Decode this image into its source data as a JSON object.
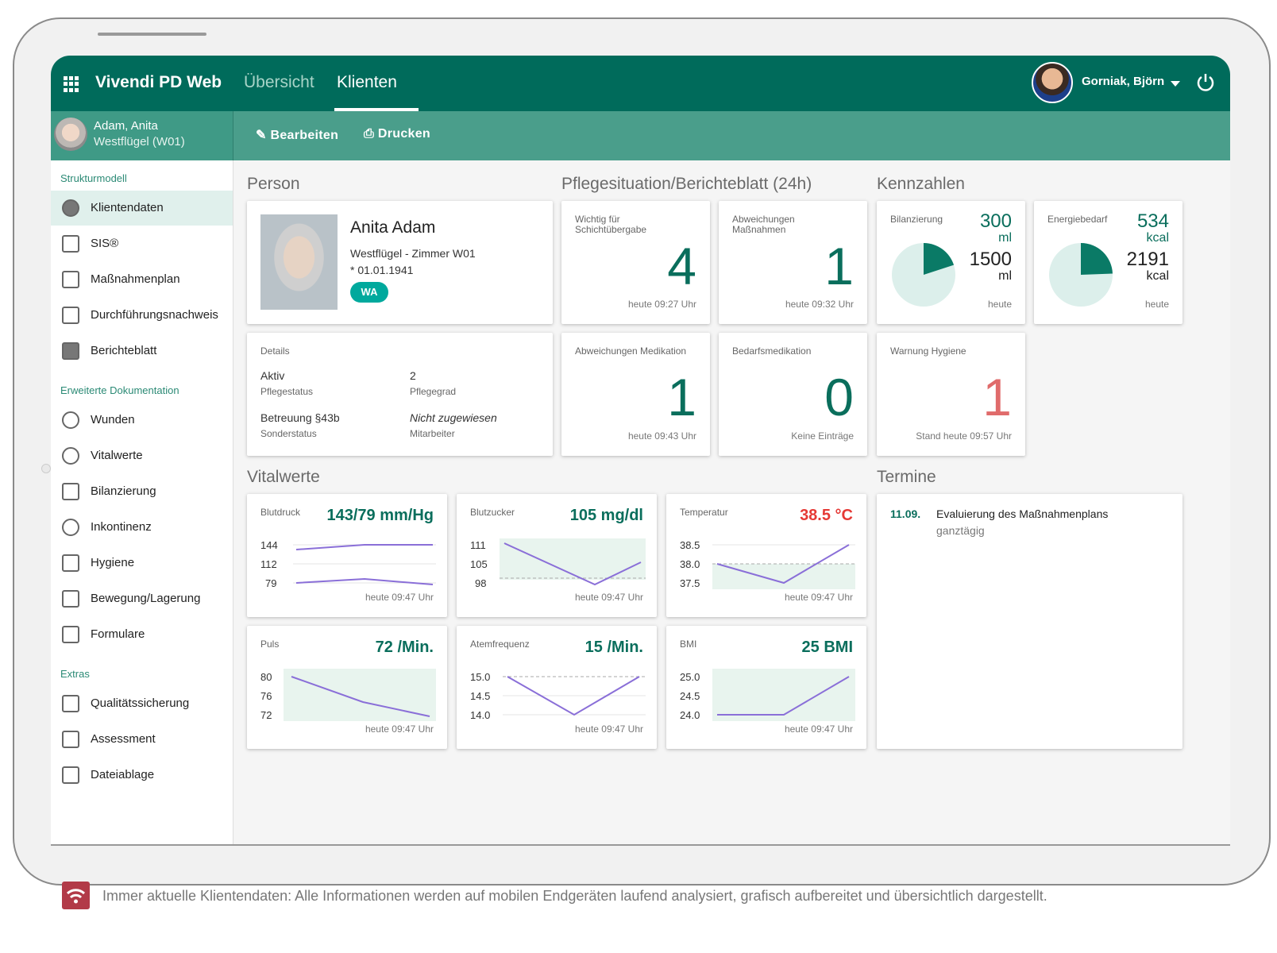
{
  "topbar": {
    "app_title": "Vivendi PD Web",
    "tabs": [
      {
        "label": "Übersicht",
        "active": false
      },
      {
        "label": "Klienten",
        "active": true
      }
    ],
    "user": "Gorniak, Björn"
  },
  "client": {
    "name": "Adam, Anita",
    "location": "Westflügel (W01)"
  },
  "toolbar": {
    "edit": "Bearbeiten",
    "print": "Drucken"
  },
  "sidebar": {
    "sections": [
      {
        "title": "Strukturmodell",
        "items": [
          "Klientendaten",
          "SIS®",
          "Maßnahmenplan",
          "Durchführungsnachweis",
          "Berichteblatt"
        ]
      },
      {
        "title": "Erweiterte Dokumentation",
        "items": [
          "Wunden",
          "Vitalwerte",
          "Bilanzierung",
          "Inkontinenz",
          "Hygiene",
          "Bewegung/Lagerung",
          "Formulare"
        ]
      },
      {
        "title": "Extras",
        "items": [
          "Qualitätssicherung",
          "Assessment",
          "Dateiablage"
        ]
      }
    ],
    "active_item": "Klientendaten"
  },
  "sections": {
    "person": "Person",
    "pflege": "Pflegesituation/Berichteblatt (24h)",
    "kennzahlen": "Kennzahlen",
    "vitalwerte": "Vitalwerte",
    "termine": "Termine"
  },
  "person": {
    "name": "Anita Adam",
    "room": "Westflügel - Zimmer W01",
    "born": "* 01.01.1941",
    "badge": "WA"
  },
  "details": {
    "title": "Details",
    "fields": [
      {
        "value": "Aktiv",
        "label": "Pflegestatus"
      },
      {
        "value": "2",
        "label": "Pflegegrad"
      },
      {
        "value": "Betreuung §43b",
        "label": "Sonderstatus"
      },
      {
        "value": "Nicht zugewiesen",
        "label": "Mitarbeiter"
      }
    ]
  },
  "pflege_cards": [
    {
      "label": "Wichtig für\nSchichtübergabe",
      "value": "4",
      "stamp": "heute 09:27 Uhr"
    },
    {
      "label": "Abweichungen\nMaßnahmen",
      "value": "1",
      "stamp": "heute 09:32 Uhr"
    },
    {
      "label": "Abweichungen Medikation",
      "value": "1",
      "stamp": "heute 09:43 Uhr"
    },
    {
      "label": "Bedarfsmedikation",
      "value": "0",
      "stamp": "Keine Einträge"
    },
    {
      "label": "Warnung Hygiene",
      "value": "1",
      "stamp": "Stand heute 09:57 Uhr",
      "color": "#e06b6b"
    }
  ],
  "kennzahlen": [
    {
      "label": "Bilanzierung",
      "value": "300",
      "unit": "ml",
      "target": "1500",
      "target_unit": "ml",
      "stamp": "heute",
      "fraction": 0.2
    },
    {
      "label": "Energiebedarf",
      "value": "534",
      "unit": "kcal",
      "target": "2191",
      "target_unit": "kcal",
      "stamp": "heute",
      "fraction": 0.244
    }
  ],
  "vitals": [
    {
      "label": "Blutdruck",
      "value": "143/79 mm/Hg",
      "ticks": [
        "144",
        "112",
        "79"
      ],
      "stamp": "heute 09:47 Uhr"
    },
    {
      "label": "Blutzucker",
      "value": "105 mg/dl",
      "ticks": [
        "111",
        "105",
        "98"
      ],
      "stamp": "heute 09:47 Uhr"
    },
    {
      "label": "Temperatur",
      "value": "38.5 °C",
      "ticks": [
        "38.5",
        "38.0",
        "37.5"
      ],
      "stamp": "heute 09:47 Uhr",
      "color": "#e53935"
    },
    {
      "label": "Puls",
      "value": "72 /Min.",
      "ticks": [
        "80",
        "76",
        "72"
      ],
      "stamp": "heute 09:47 Uhr"
    },
    {
      "label": "Atemfrequenz",
      "value": "15 /Min.",
      "ticks": [
        "15.0",
        "14.5",
        "14.0"
      ],
      "stamp": "heute 09:47 Uhr"
    },
    {
      "label": "BMI",
      "value": "25 BMI",
      "ticks": [
        "25.0",
        "24.5",
        "24.0"
      ],
      "stamp": "heute 09:47 Uhr"
    }
  ],
  "termine": [
    {
      "date": "11.09.",
      "title": "Evaluierung des Maßnahmenplans",
      "sub": "ganztägig"
    }
  ],
  "caption": "Immer aktuelle Klientendaten: Alle Informationen werden auf mobilen Endgeräten laufend analysiert, grafisch aufbereitet und übersichtlich dargestellt.",
  "colors": {
    "primary": "#006b5b",
    "accent": "#00a99d",
    "line": "#8a6fd8",
    "warning": "#e53935"
  }
}
